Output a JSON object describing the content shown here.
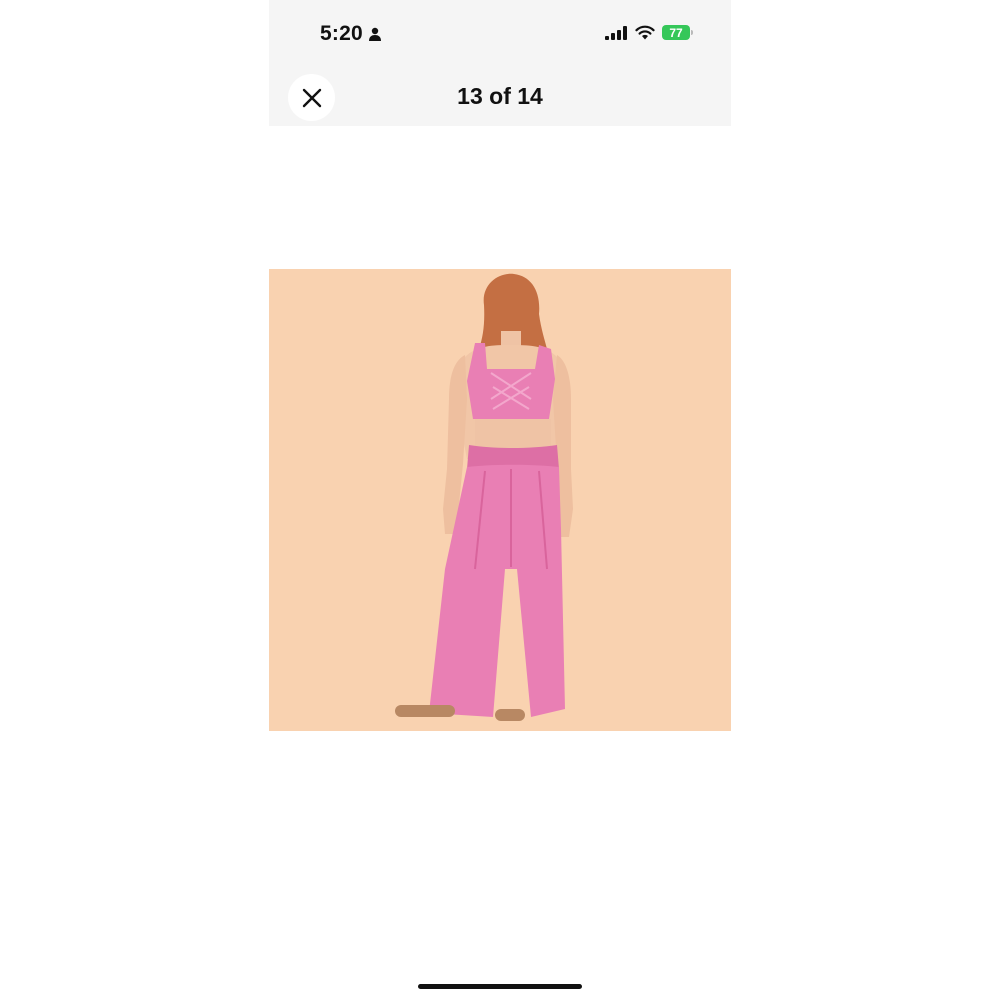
{
  "status_bar": {
    "time": "5:20",
    "battery_percent": "77",
    "battery_color": "#35c759",
    "icons": [
      "person-icon",
      "signal-icon",
      "wifi-icon",
      "battery-icon"
    ]
  },
  "header": {
    "close_icon": "close-icon",
    "page_counter": "13 of 14"
  },
  "photo": {
    "subject": "product-photo",
    "background_color": "#f9d2b0",
    "garment_color": "#e97fb4"
  }
}
